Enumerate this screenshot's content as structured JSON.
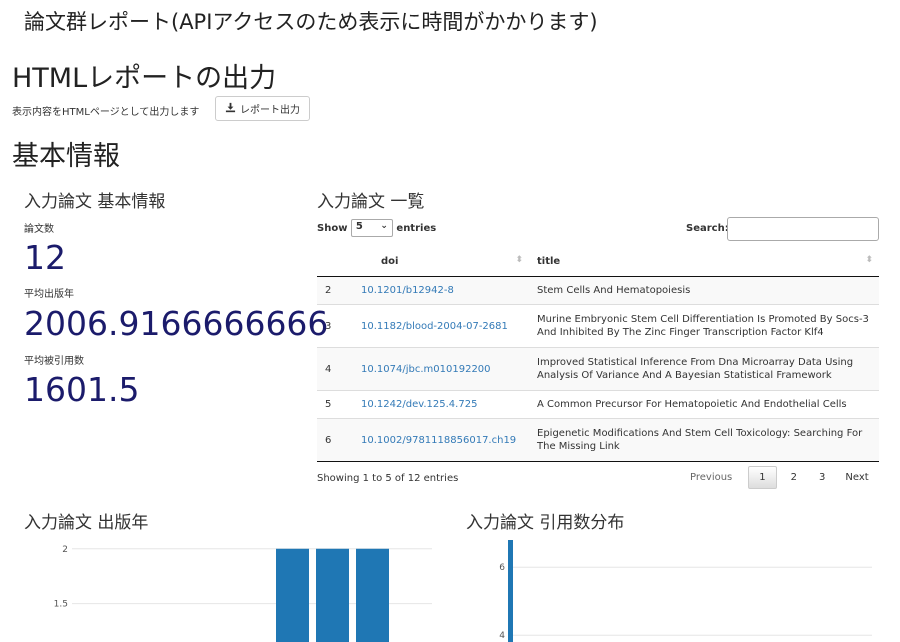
{
  "page_title": "論文群レポート(APIアクセスのため表示に時間がかかります)",
  "html_report": {
    "heading": "HTMLレポートの出力",
    "description": "表示内容をHTMLページとして出力します",
    "button_label": "レポート出力",
    "button_icon": "download-icon"
  },
  "basic_info": {
    "heading": "基本情報",
    "panel_title": "入力論文 基本情報",
    "paper_count_label": "論文数",
    "paper_count": "12",
    "avg_year_label": "平均出版年",
    "avg_year": "2006.9166666666",
    "avg_cited_label": "平均被引用数",
    "avg_cited": "1601.5"
  },
  "paper_list": {
    "title": "入力論文 一覧",
    "show_label": "Show",
    "entries_value": "5",
    "entries_label": "entries",
    "search_label": "Search:",
    "search_value": "",
    "columns": [
      "",
      "doi",
      "title"
    ],
    "rows": [
      {
        "idx": "2",
        "doi": "10.1201/b12942-8",
        "title": "Stem Cells And Hematopoiesis"
      },
      {
        "idx": "3",
        "doi": "10.1182/blood-2004-07-2681",
        "title": "Murine Embryonic Stem Cell Differentiation Is Promoted By Socs-3 And Inhibited By The Zinc Finger Transcription Factor Klf4"
      },
      {
        "idx": "4",
        "doi": "10.1074/jbc.m010192200",
        "title": "Improved Statistical Inference From Dna Microarray Data Using Analysis Of Variance And A Bayesian Statistical Framework"
      },
      {
        "idx": "5",
        "doi": "10.1242/dev.125.4.725",
        "title": "A Common Precursor For Hematopoietic And Endothelial Cells"
      },
      {
        "idx": "6",
        "doi": "10.1002/9781118856017.ch19",
        "title": "Epigenetic Modifications And Stem Cell Toxicology: Searching For The Missing Link"
      }
    ],
    "info": "Showing 1 to 5 of 12 entries",
    "pagination": {
      "previous": "Previous",
      "pages": [
        "1",
        "2",
        "3"
      ],
      "current": "1",
      "next": "Next"
    }
  },
  "charts_section": {
    "year_chart_title": "入力論文 出版年",
    "cite_chart_title": "入力論文 引用数分布"
  },
  "chart_data": [
    {
      "type": "bar",
      "title": "入力論文 出版年",
      "y_ticks": [
        "2",
        "1.5"
      ],
      "y_tick_values": [
        2,
        1.5
      ],
      "ylim_visible": [
        1.15,
        2.08
      ],
      "bar_color": "#1f77b4",
      "values": [
        2,
        2,
        2
      ]
    },
    {
      "type": "bar",
      "title": "入力論文 引用数分布",
      "y_ticks": [
        "6",
        "4"
      ],
      "y_tick_values": [
        6,
        4
      ],
      "ylim_visible": [
        3.8,
        6.8
      ],
      "bar_color": "#1f77b4",
      "values": [
        7
      ]
    }
  ]
}
